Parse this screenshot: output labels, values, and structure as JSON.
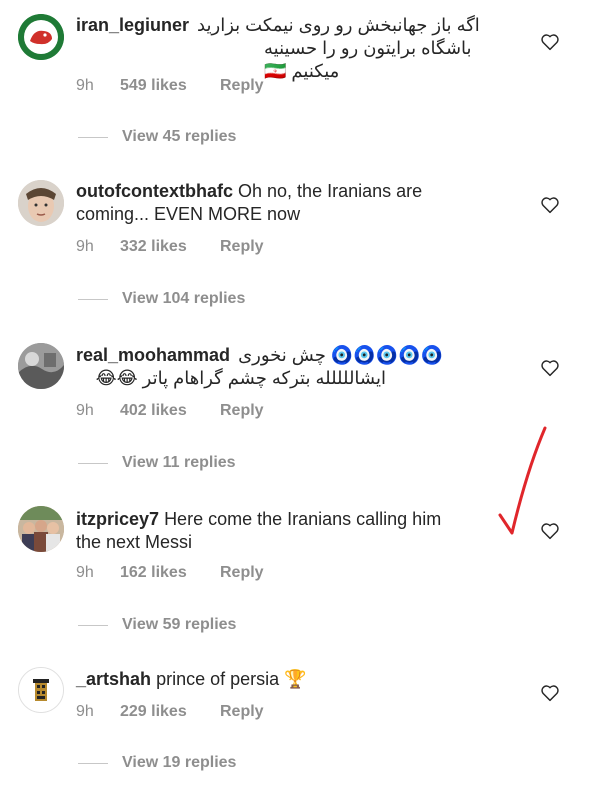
{
  "comments": [
    {
      "username": "iran_legiuner",
      "text_line1": "اگه باز جهانبخش رو روی نیمکت بزارید",
      "text_line2": "باشگاه برایتون رو را حسینیه میکنیم 🇮🇷",
      "time": "9h",
      "likes": "549 likes",
      "reply": "Reply",
      "view_replies": "View 45 replies",
      "avatar": "red-bull-logo-icon"
    },
    {
      "username": "outofcontextbhafc",
      "text_line1": "Oh no, the Iranians are",
      "text_line2": "coming... EVEN MORE now",
      "time": "9h",
      "likes": "332 likes",
      "reply": "Reply",
      "view_replies": "View 104 replies",
      "avatar": "face-photo-icon"
    },
    {
      "username": "real_moohammad",
      "text_line1": "🧿🧿🧿🧿🧿 چش نخوری",
      "text_line2": "ایشاللللله بترکه چشم گراهام پاتر 😂😂",
      "time": "9h",
      "likes": "402 likes",
      "reply": "Reply",
      "view_replies": "View 11 replies",
      "avatar": "bw-photo-icon"
    },
    {
      "username": "itzpricey7",
      "text_line1": "Here come the Iranians calling him",
      "text_line2": "the next Messi",
      "time": "9h",
      "likes": "162 likes",
      "reply": "Reply",
      "view_replies": "View 59 replies",
      "avatar": "group-photo-icon"
    },
    {
      "username": "_artshah",
      "text_line1": "prince of persia 🏆",
      "text_line2": "",
      "time": "9h",
      "likes": "229 likes",
      "reply": "Reply",
      "view_replies": "View 19 replies",
      "avatar": "persian-emblem-icon"
    }
  ],
  "colors": {
    "text": "#262626",
    "muted": "#8e8e8e",
    "annotation": "#e0262b"
  },
  "icons": [
    "heart-icon",
    "checkmark-annotation-icon"
  ]
}
